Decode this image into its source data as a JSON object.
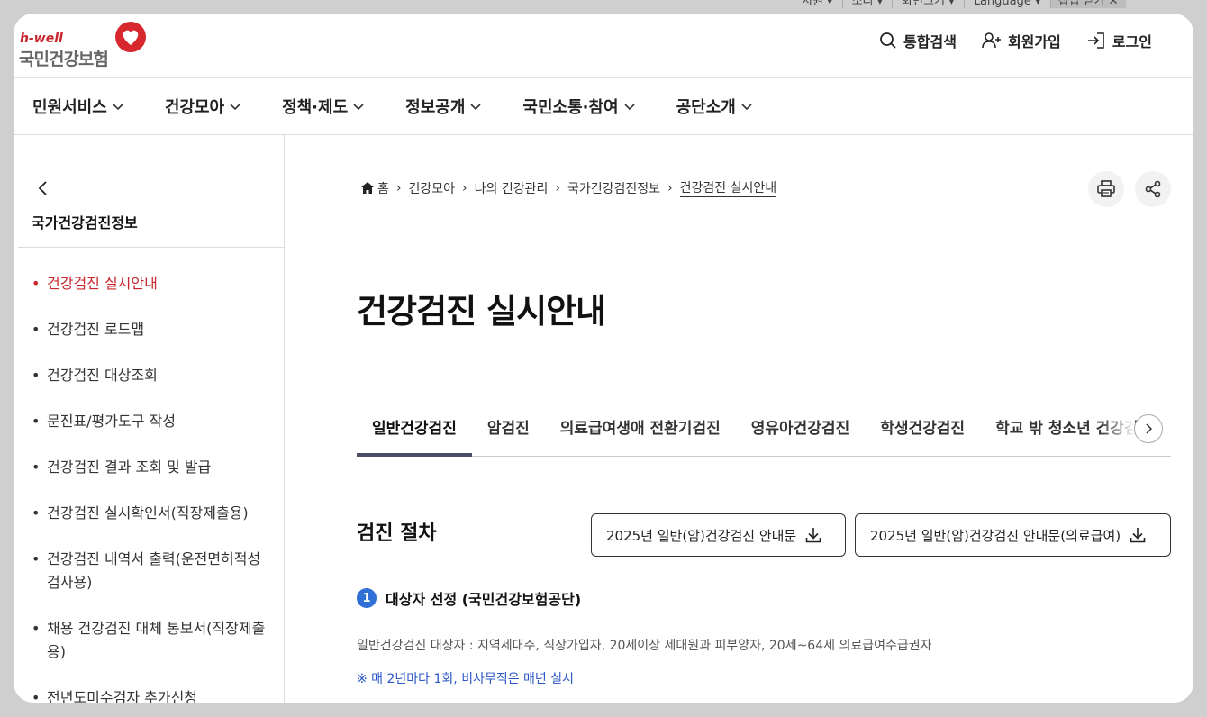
{
  "utility": {
    "items": [
      "지원",
      "소리",
      "화면크기",
      "Language"
    ],
    "close_label": "접입 닫기"
  },
  "logo": {
    "tagline": "h-well",
    "name": "국민건강보험"
  },
  "header": {
    "search_label": "통합검색",
    "join_label": "회원가입",
    "login_label": "로그인"
  },
  "gnb": [
    "민원서비스",
    "건강모아",
    "정책·제도",
    "정보공개",
    "국민소통·참여",
    "공단소개"
  ],
  "sidebar": {
    "title": "국가건강검진정보",
    "items": [
      "건강검진 실시안내",
      "건강검진 로드맵",
      "건강검진 대상조회",
      "문진표/평가도구 작성",
      "건강검진 결과 조회 및 발급",
      "건강검진 실시확인서(직장제출용)",
      "건강검진 내역서 출력(운전면허적성검사용)",
      "채용 건강검진 대체 통보서(직장제출용)",
      "전년도미수검자 추가신청"
    ]
  },
  "breadcrumb": [
    "홈",
    "건강모아",
    "나의 건강관리",
    "국가건강검진정보",
    "건강검진 실시안내"
  ],
  "page_title": "건강검진 실시안내",
  "tabs": [
    "일반건강검진",
    "암검진",
    "의료급여생애 전환기검진",
    "영유아건강검진",
    "학생건강검진",
    "학교 밖 청소년 건강검진"
  ],
  "section": {
    "title": "검진 절차",
    "download1": "2025년 일반(암)건강검진 안내문",
    "download2": "2025년 일반(암)건강검진 안내문(의료급여)",
    "step_number": "1",
    "step_title": "대상자 선정 (국민건강보험공단)",
    "description": "일반건강검진 대상자 : 지역세대주, 직장가입자, 20세이상 세대원과 피부양자, 20세~64세 의료급여수급권자",
    "note": "※ 매 2년마다 1회, 비사무직은 매년 실시"
  },
  "colors": {
    "brand_red": "#c9252c",
    "accent_blue": "#2f6fd6",
    "tab_active": "#4a4e69"
  }
}
